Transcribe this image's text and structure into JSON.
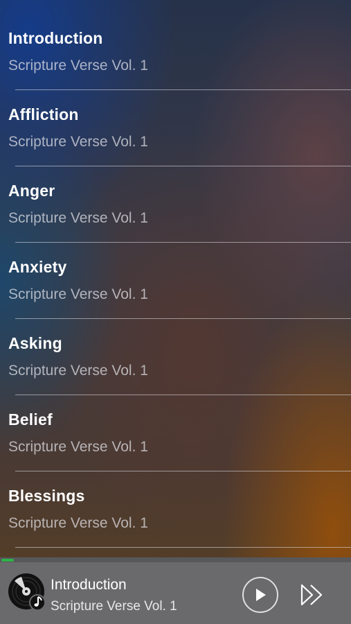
{
  "tracks": [
    {
      "title": "Introduction",
      "subtitle": "Scripture Verse Vol. 1"
    },
    {
      "title": "Affliction",
      "subtitle": "Scripture Verse Vol. 1"
    },
    {
      "title": "Anger",
      "subtitle": "Scripture Verse Vol. 1"
    },
    {
      "title": "Anxiety",
      "subtitle": "Scripture Verse Vol. 1"
    },
    {
      "title": "Asking",
      "subtitle": "Scripture Verse Vol. 1"
    },
    {
      "title": "Belief",
      "subtitle": "Scripture Verse Vol. 1"
    },
    {
      "title": "Blessings",
      "subtitle": "Scripture Verse Vol. 1"
    }
  ],
  "now_playing": {
    "title": "Introduction",
    "subtitle": "Scripture Verse Vol. 1",
    "progress": 0.035,
    "art_icon": "music-disc-icon",
    "play_icon": "play-icon",
    "next_icon": "fast-forward-icon"
  },
  "colors": {
    "progress_fill": "#2fb34a",
    "player_bg": "#6a6a6d"
  }
}
